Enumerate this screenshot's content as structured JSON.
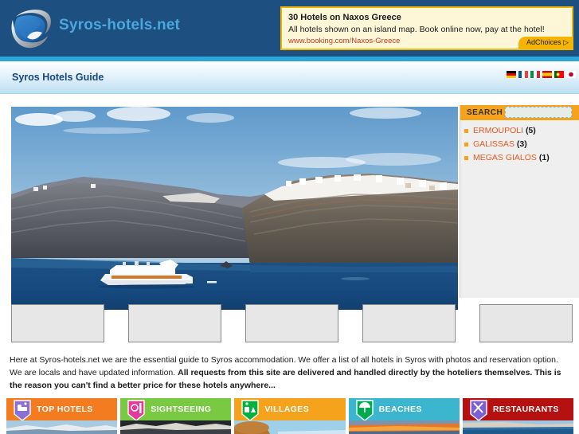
{
  "header": {
    "brand": "Syros-hotels.net",
    "logo_icon": "swirl-logo-icon"
  },
  "ad": {
    "title": "30 Hotels on Naxos Greece",
    "description": "All hotels shown on an island map. Book online now, pay at the hotel!",
    "url": "www.booking.com/Naxos-Greece",
    "adchoices_label": "AdChoices",
    "adchoices_glyph": "▷",
    "bg_color": "#fdf7d8",
    "border_color": "#f2b705"
  },
  "nav": {
    "title": "Syros Hotels Guide",
    "flags": [
      {
        "name": "flag-germany",
        "title": "Deutsch"
      },
      {
        "name": "flag-france",
        "title": "Français"
      },
      {
        "name": "flag-italy",
        "title": "Italiano"
      },
      {
        "name": "flag-spain",
        "title": "Español"
      },
      {
        "name": "flag-portugal",
        "title": "Português"
      },
      {
        "name": "flag-japan",
        "title": "日本語"
      }
    ]
  },
  "hero": {
    "alt": "Santorini caldera cliffs with white village and cruise ship"
  },
  "sidebar": {
    "search_label": "SEARCH",
    "search_value": "",
    "search_placeholder": "",
    "accent_color": "#f5a21c",
    "locations": [
      {
        "name": "ERMOUPOLI",
        "count": "(5)"
      },
      {
        "name": "GALISSAS",
        "count": "(3)"
      },
      {
        "name": "MEGAS GIALOS",
        "count": "(1)"
      }
    ]
  },
  "thumbnails": [
    {
      "label": ""
    },
    {
      "label": ""
    },
    {
      "label": ""
    },
    {
      "label": ""
    },
    {
      "label": ""
    }
  ],
  "intro": {
    "part1": "Here at Syros-hotels.net we are the essential guide to Syros accommodation. We offer a list of all hotels in Syros with photos and reservation option. We are locals and have updated information. ",
    "part2_bold": "All requests from this site are delivered and handled directly by the hoteliers themselves. This is the reason you can't find a better price for these hotels anywhere..."
  },
  "categories": [
    {
      "label": "TOP HOTELS",
      "color": "#f47c20",
      "pin_color": "#8b6fd4",
      "icon": "bed-icon"
    },
    {
      "label": "SIGHTSEEING",
      "color": "#7ac943",
      "pin_color": "#e6399b",
      "icon": "camera-icon"
    },
    {
      "label": "VILLAGES",
      "color": "#f5a21c",
      "pin_color": "#00b140",
      "icon": "village-icon"
    },
    {
      "label": "BEACHES",
      "color": "#3cb6ce",
      "pin_color": "#00a94f",
      "icon": "umbrella-icon"
    },
    {
      "label": "RESTAURANTS",
      "color": "#b51111",
      "pin_color": "#7b5fd4",
      "icon": "cutlery-icon"
    }
  ]
}
